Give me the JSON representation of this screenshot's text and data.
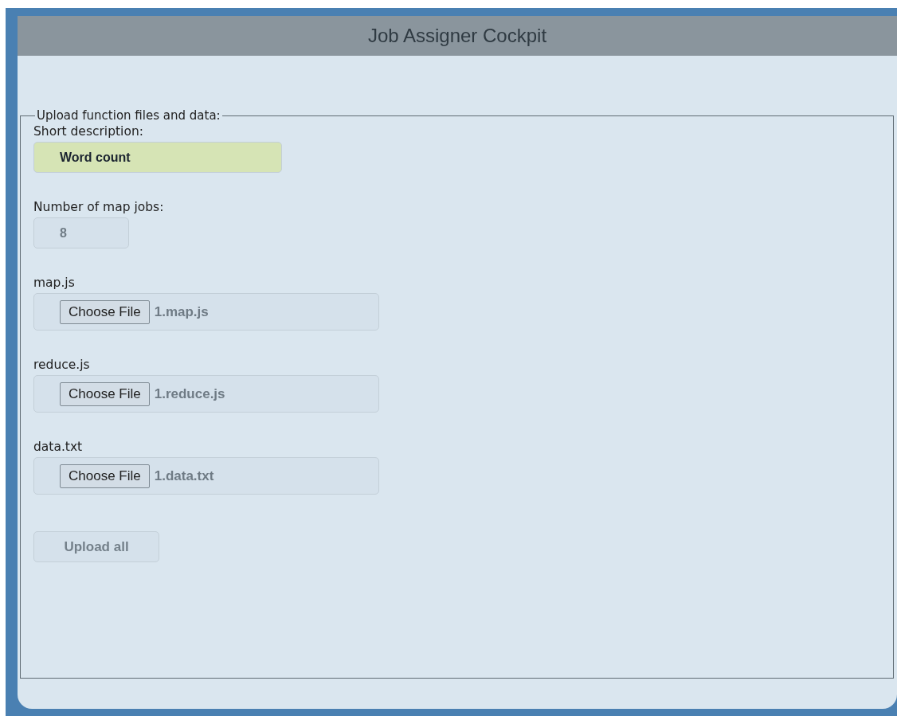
{
  "window": {
    "title": "Job Assigner Cockpit"
  },
  "form": {
    "legend": "Upload function files and data:",
    "fields": [
      {
        "kind": "text",
        "label": "Short description:",
        "value": "Word count"
      },
      {
        "kind": "number",
        "label": "Number of map jobs:",
        "value": "8"
      },
      {
        "kind": "file",
        "label": "map.js",
        "button": "Choose File",
        "value": "1.map.js"
      },
      {
        "kind": "file",
        "label": "reduce.js",
        "button": "Choose File",
        "value": "1.reduce.js"
      },
      {
        "kind": "file",
        "label": "data.txt",
        "button": "Choose File",
        "value": "1.data.txt"
      }
    ],
    "submit": {
      "label": "Upload all",
      "disabled": true
    }
  }
}
